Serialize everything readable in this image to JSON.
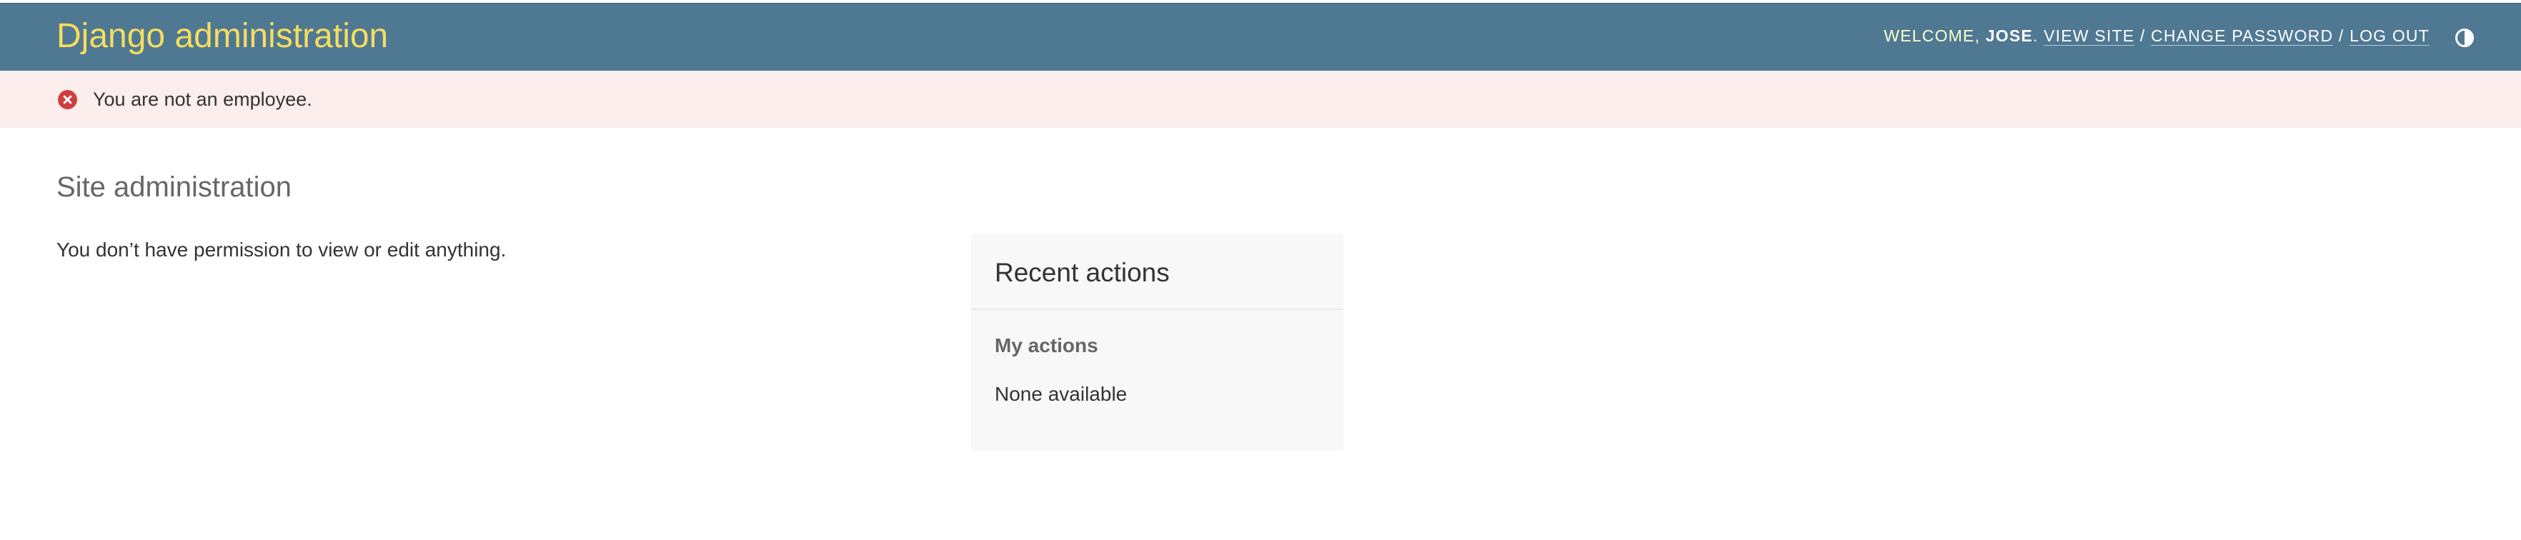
{
  "header": {
    "branding": "Django administration",
    "user_tools": {
      "welcome_label": "Welcome,",
      "username": "Jose",
      "username_suffix": ".",
      "view_site": "View site",
      "separator": "/",
      "change_password": "Change password",
      "log_out": "Log out"
    },
    "theme_toggle_icon": "contrast-half-circle-icon"
  },
  "messages": {
    "error_icon": "error-x-circle-icon",
    "error_text": "You are not an employee."
  },
  "main": {
    "title": "Site administration",
    "permission_text": "You don’t have permission to view or edit anything."
  },
  "recent_actions": {
    "title": "Recent actions",
    "my_actions_label": "My actions",
    "empty_text": "None available"
  },
  "colors": {
    "header_bg": "#4f7893",
    "branding": "#f5dd5d",
    "user_tools_text": "#ffffcc",
    "error_bg": "#fbeeed",
    "error_icon": "#cf3e3e",
    "panel_bg": "#f8f8f8"
  }
}
